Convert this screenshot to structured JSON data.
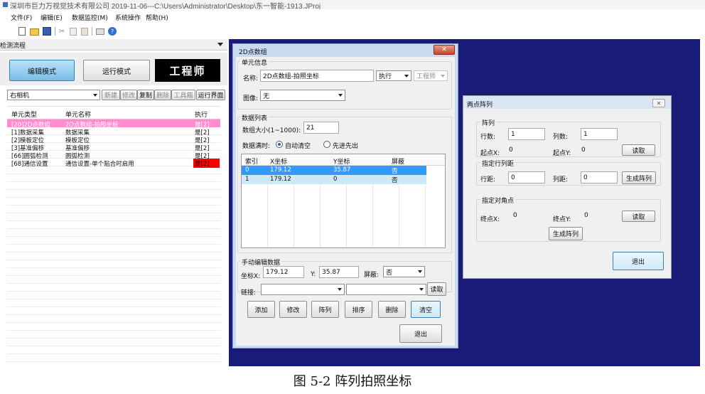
{
  "title_bar": {
    "text": "深圳市巨力万视觉技术有限公司  2019-11-06---C:\\Users\\Administrator\\Desktop\\东一智能-1913.JProj"
  },
  "menu": [
    "文件(F)",
    "编辑(E)",
    "数据监控(M)",
    "系统操作",
    "帮助(H)"
  ],
  "left_panel": {
    "header": "检测流程",
    "edit_mode": "编辑模式",
    "run_mode": "运行模式",
    "role": "工程师",
    "camera": "右相机",
    "tools": [
      "新建",
      "修改",
      "复制",
      "删除",
      "工具箱",
      "运行界面"
    ],
    "columns": [
      "单元类型",
      "单元名称",
      "执行"
    ],
    "rows": [
      {
        "type": "[20]2D点数组",
        "name": "2D点数组-拍照坐标",
        "exec": "是[2]",
        "style": "selected"
      },
      {
        "type": "[1]数据采集",
        "name": "数据采集",
        "exec": "是[2]",
        "style": "normal"
      },
      {
        "type": "[2]模板定位",
        "name": "模板定位",
        "exec": "是[2]",
        "style": "normal"
      },
      {
        "type": "[3]基准偏移",
        "name": "基准偏移",
        "exec": "是[2]",
        "style": "normal"
      },
      {
        "type": "[66]圆弧检测",
        "name": "圆弧检测",
        "exec": "是[2]",
        "style": "normal"
      },
      {
        "type": "[68]通信设置",
        "name": "通信设置-单个贴合时启用",
        "exec": "是[2]",
        "style": "alert"
      }
    ]
  },
  "dialog_2d": {
    "title": "2D点数组",
    "unit_info": "单元信息",
    "name_label": "名称:",
    "name_value": "2D点数组-拍照坐标",
    "exec_value": "执行",
    "role_value": "工程师",
    "image_label": "图像:",
    "image_value": "无",
    "data_list": "数据列表",
    "size_label": "数组大小(1~1000):",
    "size_value": "21",
    "full_label": "数据满时:",
    "radio_auto": "自动清空",
    "radio_fifo": "先进先出",
    "columns": [
      "索引",
      "X坐标",
      "Y坐标",
      "屏蔽"
    ],
    "rows": [
      {
        "index": "0",
        "x": "179.12",
        "y": "35.87",
        "mask": "否"
      },
      {
        "index": "1",
        "x": "179.12",
        "y": "0",
        "mask": "否"
      }
    ],
    "manual": "手动编辑数据",
    "coord_x_label": "坐标X:",
    "coord_x_value": "179.12",
    "y_label": "Y:",
    "y_value": "35.87",
    "mask_label": "屏蔽:",
    "mask_value": "否",
    "link_label": "链接:",
    "read": "读取",
    "actions": [
      "添加",
      "修改",
      "阵列",
      "排序",
      "删除",
      "清空"
    ],
    "exit": "退出"
  },
  "dialog_array": {
    "title": "两点阵列",
    "array_group": "阵列",
    "rows_label": "行数:",
    "rows_value": "1",
    "cols_label": "列数:",
    "cols_value": "1",
    "start_x_label": "起点X:",
    "start_x_value": "0",
    "start_y_label": "起点Y:",
    "start_y_value": "0",
    "read1": "读取",
    "spacing_group": "指定行列距",
    "row_dist_label": "行距:",
    "row_dist_value": "0",
    "col_dist_label": "列距:",
    "col_dist_value": "0",
    "gen1": "生成阵列",
    "diag_group": "指定对角点",
    "end_x_label": "终点X:",
    "end_x_value": "0",
    "end_y_label": "终点Y:",
    "end_y_value": "0",
    "read2": "读取",
    "gen2": "生成阵列",
    "exit": "退出"
  },
  "caption": "图 5-2 阵列拍照坐标",
  "colors": {
    "desktop": "#1a1a78",
    "selected": "#ff8ccf",
    "alert": "#ff0000",
    "list_select": "#3399ff",
    "list_row2": "#cde8f6"
  }
}
